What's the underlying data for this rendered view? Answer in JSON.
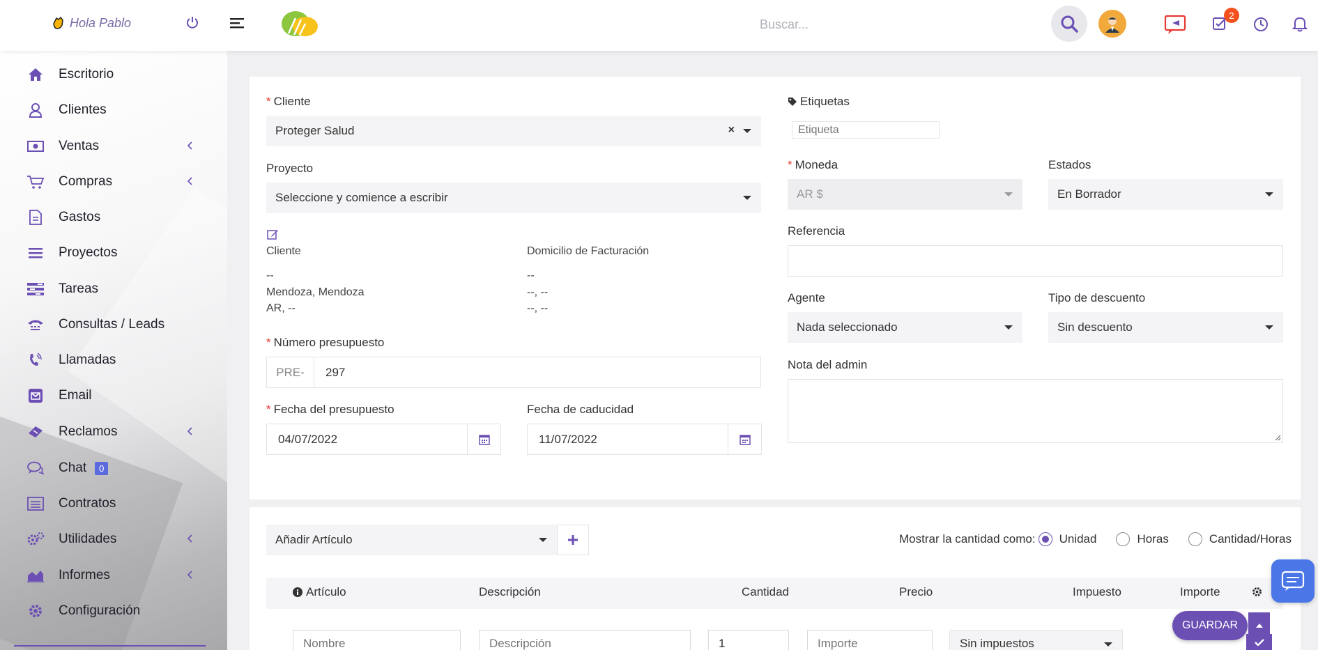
{
  "header": {
    "greeting": "Hola Pablo",
    "search_placeholder": "Buscar...",
    "todo_badge": "2"
  },
  "sidebar": {
    "items": [
      {
        "label": "Escritorio",
        "icon": "home-icon"
      },
      {
        "label": "Clientes",
        "icon": "user-icon"
      },
      {
        "label": "Ventas",
        "icon": "money-icon"
      },
      {
        "label": "Compras",
        "icon": "cart-icon"
      },
      {
        "label": "Gastos",
        "icon": "file-icon"
      },
      {
        "label": "Proyectos",
        "icon": "bars-icon"
      },
      {
        "label": "Tareas",
        "icon": "tasks-icon"
      },
      {
        "label": "Consultas / Leads",
        "icon": "tty-icon"
      },
      {
        "label": "Llamadas",
        "icon": "phone-volume-icon"
      },
      {
        "label": "Email",
        "icon": "envelope-icon"
      },
      {
        "label": "Reclamos",
        "icon": "ticket-icon"
      },
      {
        "label": "Chat",
        "icon": "comments-icon"
      },
      {
        "label": "Contratos",
        "icon": "list-alt-icon"
      },
      {
        "label": "Utilidades",
        "icon": "cogs-icon"
      },
      {
        "label": "Informes",
        "icon": "area-chart-icon"
      },
      {
        "label": "Configuración",
        "icon": "cog-icon"
      }
    ],
    "chat_badge": "0"
  },
  "form": {
    "cliente_label": "Cliente",
    "cliente_value": "Proteger Salud",
    "proyecto_label": "Proyecto",
    "proyecto_value": "Seleccione y comience a escribir",
    "client_col_title": "Cliente",
    "client_lines": [
      "--",
      "Mendoza, Mendoza",
      "AR, --"
    ],
    "billing_col_title": "Domicilio de Facturación",
    "billing_lines": [
      "--",
      "--, --",
      "--, --"
    ],
    "numero_label": "Número presupuesto",
    "numero_prefix": "PRE-",
    "numero_value": "297",
    "fecha_label": "Fecha del presupuesto",
    "fecha_value": "04/07/2022",
    "caducidad_label": "Fecha de caducidad",
    "caducidad_value": "11/07/2022",
    "etiquetas_label": "Etiquetas",
    "etiqueta_placeholder": "Etiqueta",
    "moneda_label": "Moneda",
    "moneda_value": "AR $",
    "estados_label": "Estados",
    "estados_value": "En Borrador",
    "referencia_label": "Referencia",
    "referencia_value": "",
    "agente_label": "Agente",
    "agente_value": "Nada seleccionado",
    "descuento_label": "Tipo de descuento",
    "descuento_value": "Sin descuento",
    "nota_label": "Nota del admin",
    "nota_value": ""
  },
  "items": {
    "add_article": "Añadir Artículo",
    "qty_label": "Mostrar la cantidad como:",
    "qty_options": [
      "Unidad",
      "Horas",
      "Cantidad/Horas"
    ],
    "qty_selected": "Unidad",
    "columns": [
      "Artículo",
      "Descripción",
      "Cantidad",
      "Precio",
      "Impuesto",
      "Importe"
    ],
    "row": {
      "name_placeholder": "Nombre",
      "desc_placeholder": "Descripción",
      "qty_value": "1",
      "price_placeholder": "Importe",
      "tax_value": "Sin impuestos"
    }
  },
  "actions": {
    "save_label": "GUARDAR"
  },
  "colors": {
    "accent": "#6b4fb3",
    "badge": "#f4511e",
    "chat_fab": "#4a76e8",
    "required": "#e53935"
  }
}
